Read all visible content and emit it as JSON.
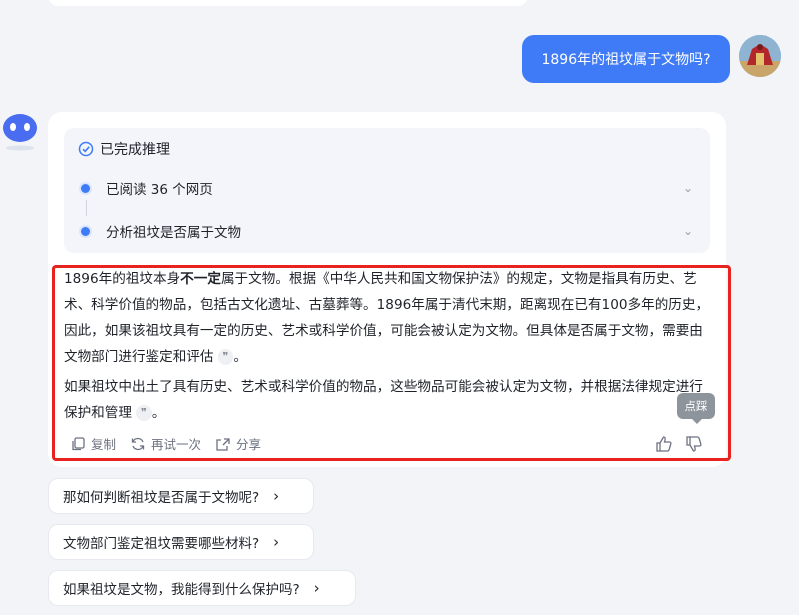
{
  "user_message": "1896年的祖坟属于文物吗?",
  "reasoning": {
    "title": "已完成推理",
    "steps": [
      {
        "label": "已阅读 36 个网页"
      },
      {
        "label": "分析祖坟是否属于文物"
      }
    ]
  },
  "answer": {
    "p1_a": "1896年的祖坟本身",
    "p1_bold": "不一定",
    "p1_b": "属于文物。根据《中华人民共和国文物保护法》的规定，文物是指具有历史、艺术、科学价值的物品，包括古文化遗址、古墓葬等。1896年属于清代末期，距离现在已有100多年的历史，因此，如果该祖坟具有一定的历史、艺术或科学价值，可能会被认定为文物。但具体是否属于文物，需要由文物部门进行鉴定和评估",
    "p1_end": "。",
    "p2": "如果祖坟中出土了具有历史、艺术或科学价值的物品，这些物品可能会被认定为文物，并根据法律规定进行保护和管理",
    "p2_end": "。",
    "quote_glyph": "❞"
  },
  "actions": {
    "copy": "复制",
    "retry": "再试一次",
    "share": "分享"
  },
  "tooltip": "点踩",
  "suggestions": [
    {
      "label": "那如何判断祖坟是否属于文物呢?"
    },
    {
      "label": "文物部门鉴定祖坟需要哪些材料?"
    },
    {
      "label": "如果祖坟是文物，我能得到什么保护吗?"
    }
  ],
  "colors": {
    "accent": "#3f7bf6",
    "highlight_border": "#e8231f"
  }
}
